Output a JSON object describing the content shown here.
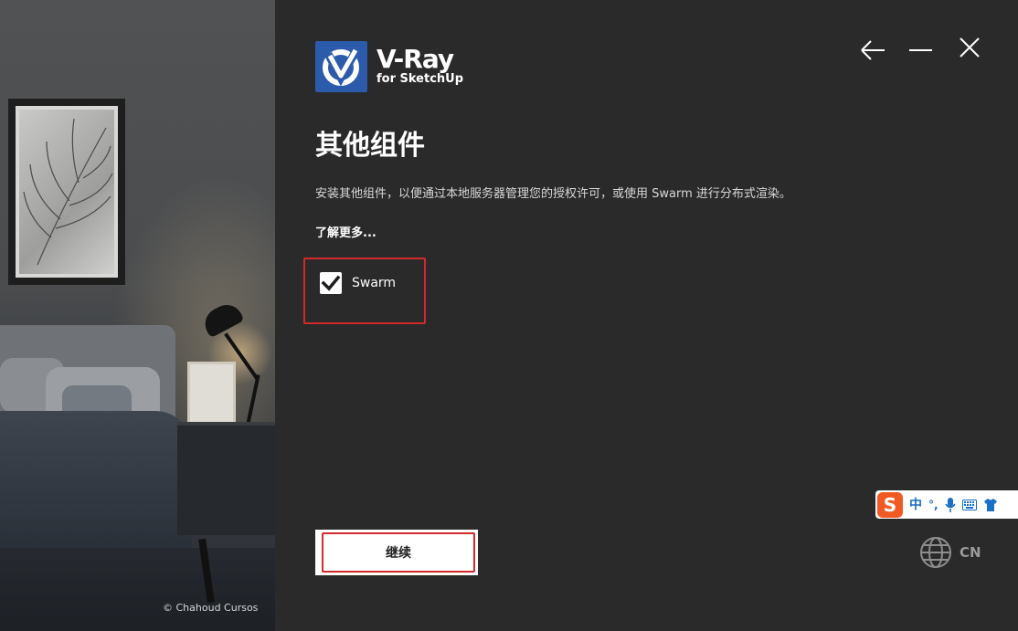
{
  "photo": {
    "credit": "© Chahoud Cursos"
  },
  "logo": {
    "title": "V-Ray",
    "subtitle": "for SketchUp",
    "brand_color": "#2d5bab"
  },
  "window_controls": {
    "back_icon": "arrow-left-icon",
    "minimize_icon": "minimize-icon",
    "close_icon": "close-icon"
  },
  "main": {
    "title": "其他组件",
    "description": "安装其他组件，以便通过本地服务器管理您的授权许可，或使用 Swarm 进行分布式渲染。",
    "learn_more": "了解更多...",
    "components": [
      {
        "label": "Swarm",
        "checked": true
      }
    ],
    "continue_label": "继续"
  },
  "language": {
    "label": "CN",
    "icon": "globe-icon"
  },
  "ime_toolbar": {
    "logo": "S",
    "mode": "中",
    "punct": "°,"
  },
  "colors": {
    "background": "#2a2a2b",
    "highlight": "#d3292a",
    "ime_blue": "#1a6fc6",
    "ime_orange": "#f05a22"
  }
}
